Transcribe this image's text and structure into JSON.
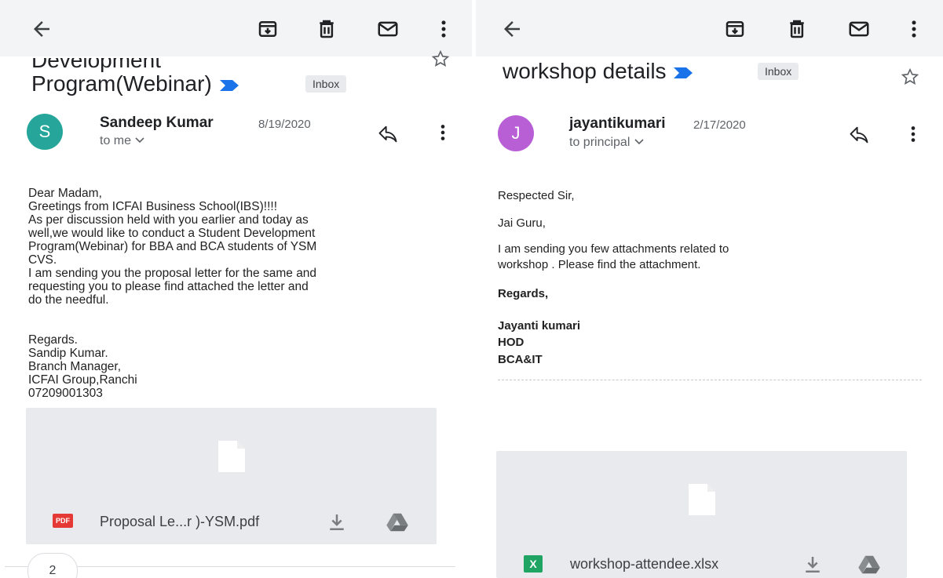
{
  "left": {
    "subject_line1": "Development",
    "subject_line2": "Program(Webinar)",
    "label": "Inbox",
    "avatar_letter": "S",
    "avatar_color": "#26a69a",
    "sender": "Sandeep Kumar",
    "date": "8/19/2020",
    "recipient": "to me",
    "body": "Dear Madam,\nGreetings from ICFAI Business School(IBS)!!!!\nAs per discussion held with you earlier and today as\nwell,we would like to conduct a Student Development\nProgram(Webinar) for BBA and BCA students of YSM\nCVS.\nI am sending you the proposal letter for the same and\nrequesting you to please find attached the letter and\ndo the needful.\n\n\nRegards.\nSandip Kumar.\nBranch Manager,\nICFAI Group,Ranchi\n07209001303",
    "attachment": {
      "type_badge": "PDF",
      "name": "Proposal Le...r )-YSM.pdf"
    },
    "more_count": "2"
  },
  "right": {
    "subject": "workshop details",
    "label": "Inbox",
    "avatar_letter": "J",
    "avatar_color": "#b95fd6",
    "sender": "jayantikumari",
    "date": "2/17/2020",
    "recipient": "to principal",
    "body": {
      "greeting": "Respected Sir,",
      "salutation": "Jai Guru,",
      "para_line1": "I am sending you few attachments related to",
      "para_line2": "workshop . Please find the attachment.",
      "regards": "Regards,",
      "signature_name": "Jayanti kumari",
      "signature_title": "HOD",
      "signature_dept": "BCA&IT"
    },
    "attachment": {
      "type_badge": "X",
      "name": "workshop-attendee.xlsx"
    }
  },
  "colors": {
    "toolbar_bg": "#f2f4f5",
    "important_marker": "#1a73e8",
    "pdf_badge": "#e53935",
    "xlsx_badge": "#1fa463",
    "attachment_bg": "#e8eaed"
  },
  "icons": {
    "back": "arrow-left-icon",
    "archive": "archive-icon",
    "delete": "trash-icon",
    "mark_unread": "mail-icon",
    "more": "more-vertical-icon",
    "star": "star-outline-icon",
    "reply": "reply-icon",
    "download": "download-icon",
    "drive": "google-drive-icon",
    "file": "file-icon"
  }
}
